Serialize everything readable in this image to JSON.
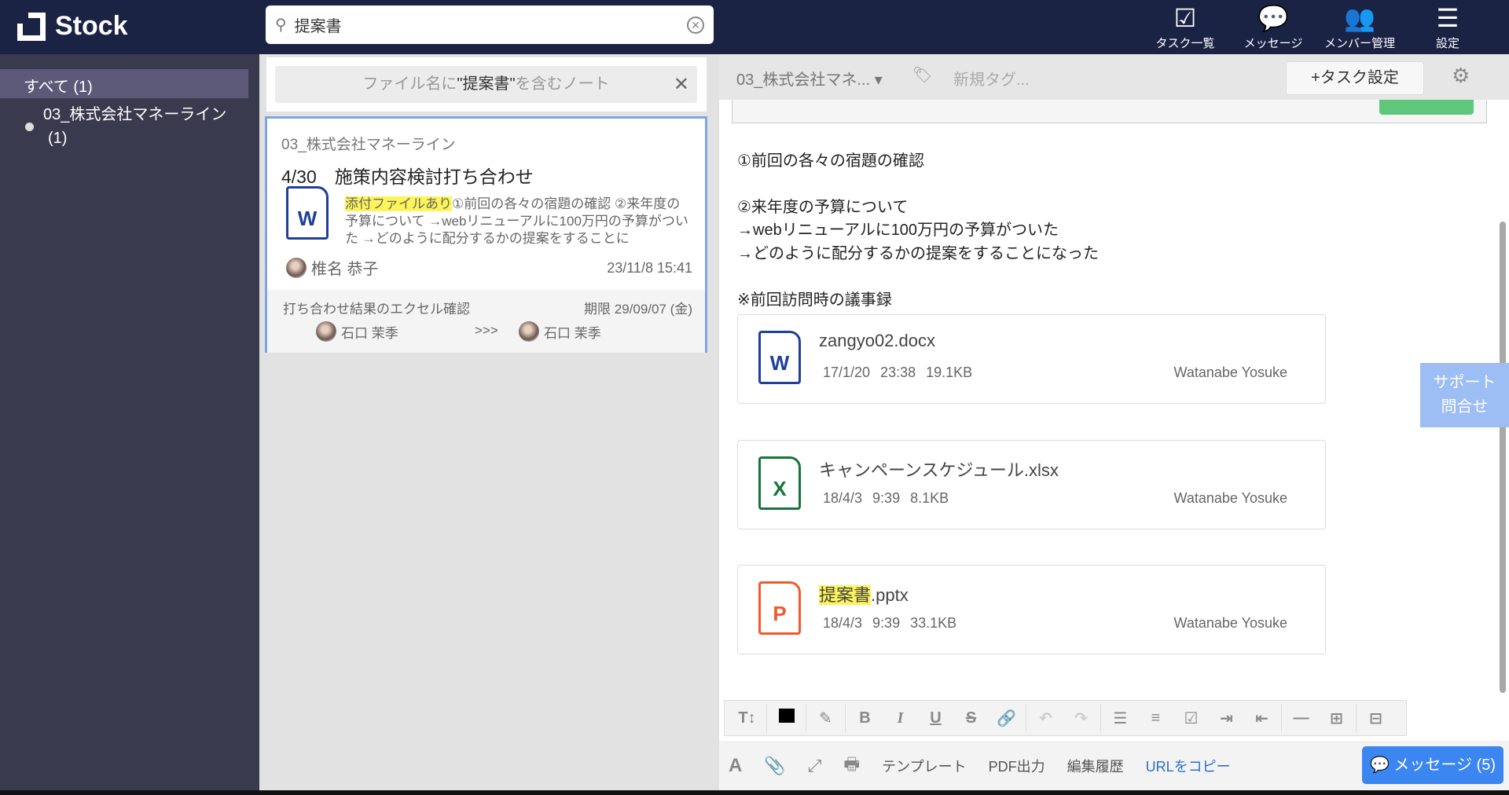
{
  "app": {
    "name": "Stock"
  },
  "search": {
    "value": "提案書"
  },
  "header_nav": [
    {
      "label": "タスク一覧",
      "icon": "checkbox-icon"
    },
    {
      "label": "メッセージ",
      "icon": "chat-bubble-icon"
    },
    {
      "label": "メンバー管理",
      "icon": "users-icon"
    },
    {
      "label": "設定",
      "icon": "menu-icon"
    }
  ],
  "sidebar": {
    "all": "すべて (1)",
    "folders": [
      {
        "name": "03_株式会社マネーライン",
        "count": "(1)"
      }
    ]
  },
  "filter": {
    "prefix": "ファイル名に",
    "keyword": "\"提案書\"",
    "suffix": "を含むノート",
    "close": "✕"
  },
  "note_card": {
    "folder": "03_株式会社マネーライン",
    "title": "4/30　施策内容検討打ち合わせ",
    "badge": "添付ファイルあり",
    "snippet": "①前回の各々の宿題の確認 ②来年度の予算について →webリニューアルに100万円の予算がついた →どのように配分するかの提案をすることに",
    "author": "椎名 恭子",
    "date": "23/11/8 15:41",
    "task": {
      "title": "打ち合わせ結果のエクセル確認",
      "due": "期限 29/09/07 (金)",
      "from": "石口 茉季",
      "arrow": ">>>",
      "to": "石口 茉季"
    }
  },
  "note": {
    "folder": "03_株式会社マネ...",
    "tag_placeholder": "新規タグ...",
    "task_button": "+タスク設定",
    "lines": [
      "①前回の各々の宿題の確認",
      "②来年度の予算について",
      "→webリニューアルに100万円の予算がついた",
      "→どのように配分するかの提案をすることになった",
      "※前回訪問時の議事録"
    ],
    "files": [
      {
        "type": "W",
        "color": "#1f3f99",
        "name_hl": "",
        "name": "zangyo02.docx",
        "date": "17/1/20 23:38",
        "size": "19.1KB",
        "owner": "Watanabe Yosuke"
      },
      {
        "type": "X",
        "color": "#17743a",
        "name_hl": "",
        "name": "キャンペーンスケジュール.xlsx",
        "date": "18/4/3 9:39",
        "size": "8.1KB",
        "owner": "Watanabe Yosuke"
      },
      {
        "type": "P",
        "color": "#f05a2a",
        "name_hl": "提案書",
        "name": ".pptx",
        "date": "18/4/3 9:39",
        "size": "33.1KB",
        "owner": "Watanabe Yosuke"
      }
    ]
  },
  "support": {
    "line1": "サポート",
    "line2": "問合せ"
  },
  "bottom": {
    "template": "テンプレート",
    "pdf": "PDF出力",
    "history": "編集履歴",
    "copy_url": "URLをコピー",
    "message": "メッセージ (5)"
  }
}
